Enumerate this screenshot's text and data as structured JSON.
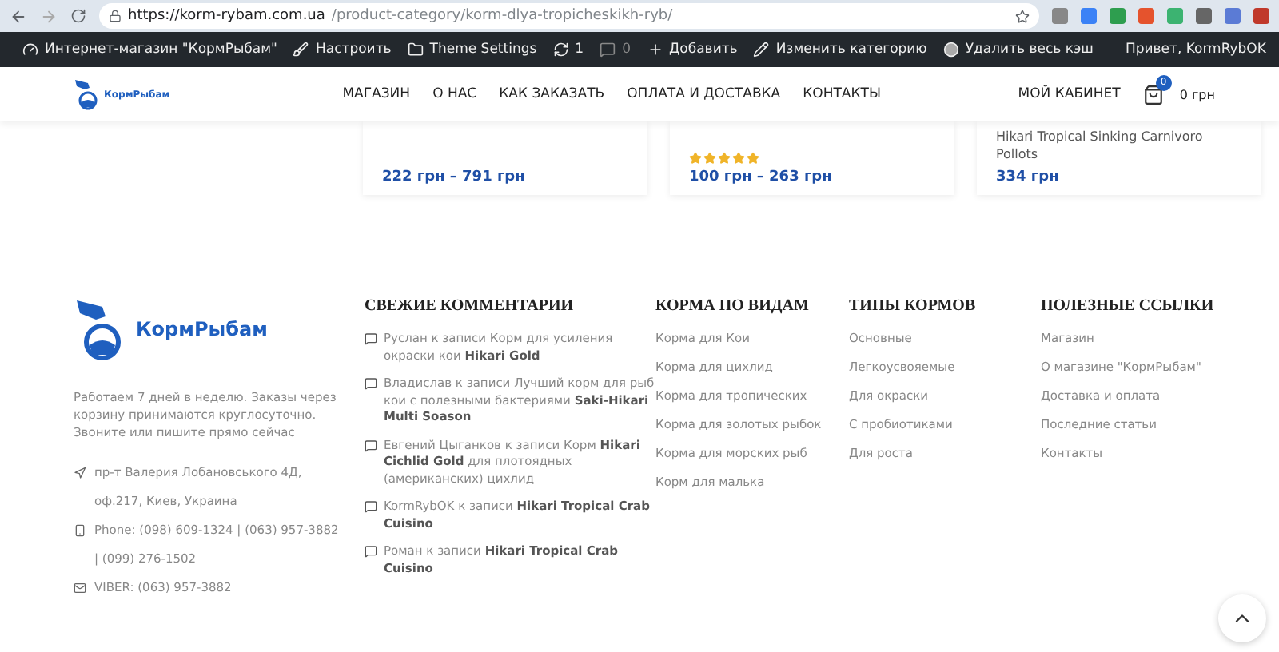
{
  "browser": {
    "url_host": "https://korm-rybam.com.ua",
    "url_path": "/product-category/korm-dlya-tropicheskikh-ryb/"
  },
  "admin_bar": {
    "items": [
      {
        "kind": "site",
        "label": "Интернет-магазин \"КормРыбам\""
      },
      {
        "kind": "brush",
        "label": "Настроить"
      },
      {
        "kind": "folder",
        "label": "Theme Settings"
      },
      {
        "kind": "updates",
        "label": "1"
      },
      {
        "kind": "comments",
        "label": "0"
      },
      {
        "kind": "add",
        "label": "Добавить"
      },
      {
        "kind": "pencil",
        "label": "Изменить категорию"
      },
      {
        "kind": "cache",
        "label": "Удалить весь кэш"
      }
    ],
    "greeting": "Привет, KormRybOK"
  },
  "header": {
    "logo": "КормРыбам",
    "nav": [
      "МАГАЗИН",
      "О НАС",
      "КАК ЗАКАЗАТЬ",
      "ОПЛАТА И ДОСТАВКА",
      "КОНТАКТЫ"
    ],
    "account": "МОЙ КАБИНЕТ",
    "cart_count": "0",
    "cart_total": "0 грн"
  },
  "products": [
    {
      "price": "222 грн – 791 грн"
    },
    {
      "stars": 5,
      "price": "100 грн – 263 грн"
    },
    {
      "title": "Hikari Tropical Sinking Carnivoro Pollots",
      "price": "334 грн"
    }
  ],
  "footer": {
    "logo": "КормРыбам",
    "about": "Работаем 7 дней в неделю. Заказы через корзину принимаются круглосуточно. Звоните или пишите прямо сейчас",
    "contacts": [
      {
        "kind": "address",
        "lines": [
          "пр-т Валерия Лобановського 4Д,",
          "оф.217, Киев, Украина"
        ]
      },
      {
        "kind": "phone",
        "lines": [
          "Phone: (098) 609-1324 | (063) 957-3882",
          "| (099) 276-1502"
        ]
      },
      {
        "kind": "mail",
        "lines": [
          "VIBER: (063) 957-3882"
        ]
      }
    ],
    "comments": {
      "title": "СВЕЖИЕ КОММЕНТАРИИ",
      "items": [
        "Руслан к записи Корм для усиления окраски кои **Hikari Gold**",
        "Владислав к записи Лучший корм для рыб кои с полезными бактериями **Saki-Hikari Multi Soason**",
        "Евгений Цыганков к записи Корм **Hikari Cichlid Gold** для плотоядных (американских) цихлид",
        "KormRybOK к записи **Hikari Tropical Crab Cuisino**",
        "Роман к записи **Hikari Tropical Crab Cuisino**"
      ]
    },
    "columns": [
      {
        "title": "КОРМА ПО ВИДАМ",
        "links": [
          "Корма для Кои",
          "Корма для цихлид",
          "Корма для тропических",
          "Корма для золотых рыбок",
          "Корма для морских рыб",
          "Корм для малька"
        ]
      },
      {
        "title": "ТИПЫ КОРМОВ",
        "links": [
          "Основные",
          "Легкоусвояемые",
          "Для окраски",
          "С пробиотиками",
          "Для роста"
        ]
      },
      {
        "title": "ПОЛЕЗНЫЕ ССЫЛКИ",
        "links": [
          "Магазин",
          "О магазине \"КормРыбам\"",
          "Доставка и оплата",
          "Последние статьи",
          "Контакты"
        ]
      }
    ]
  }
}
